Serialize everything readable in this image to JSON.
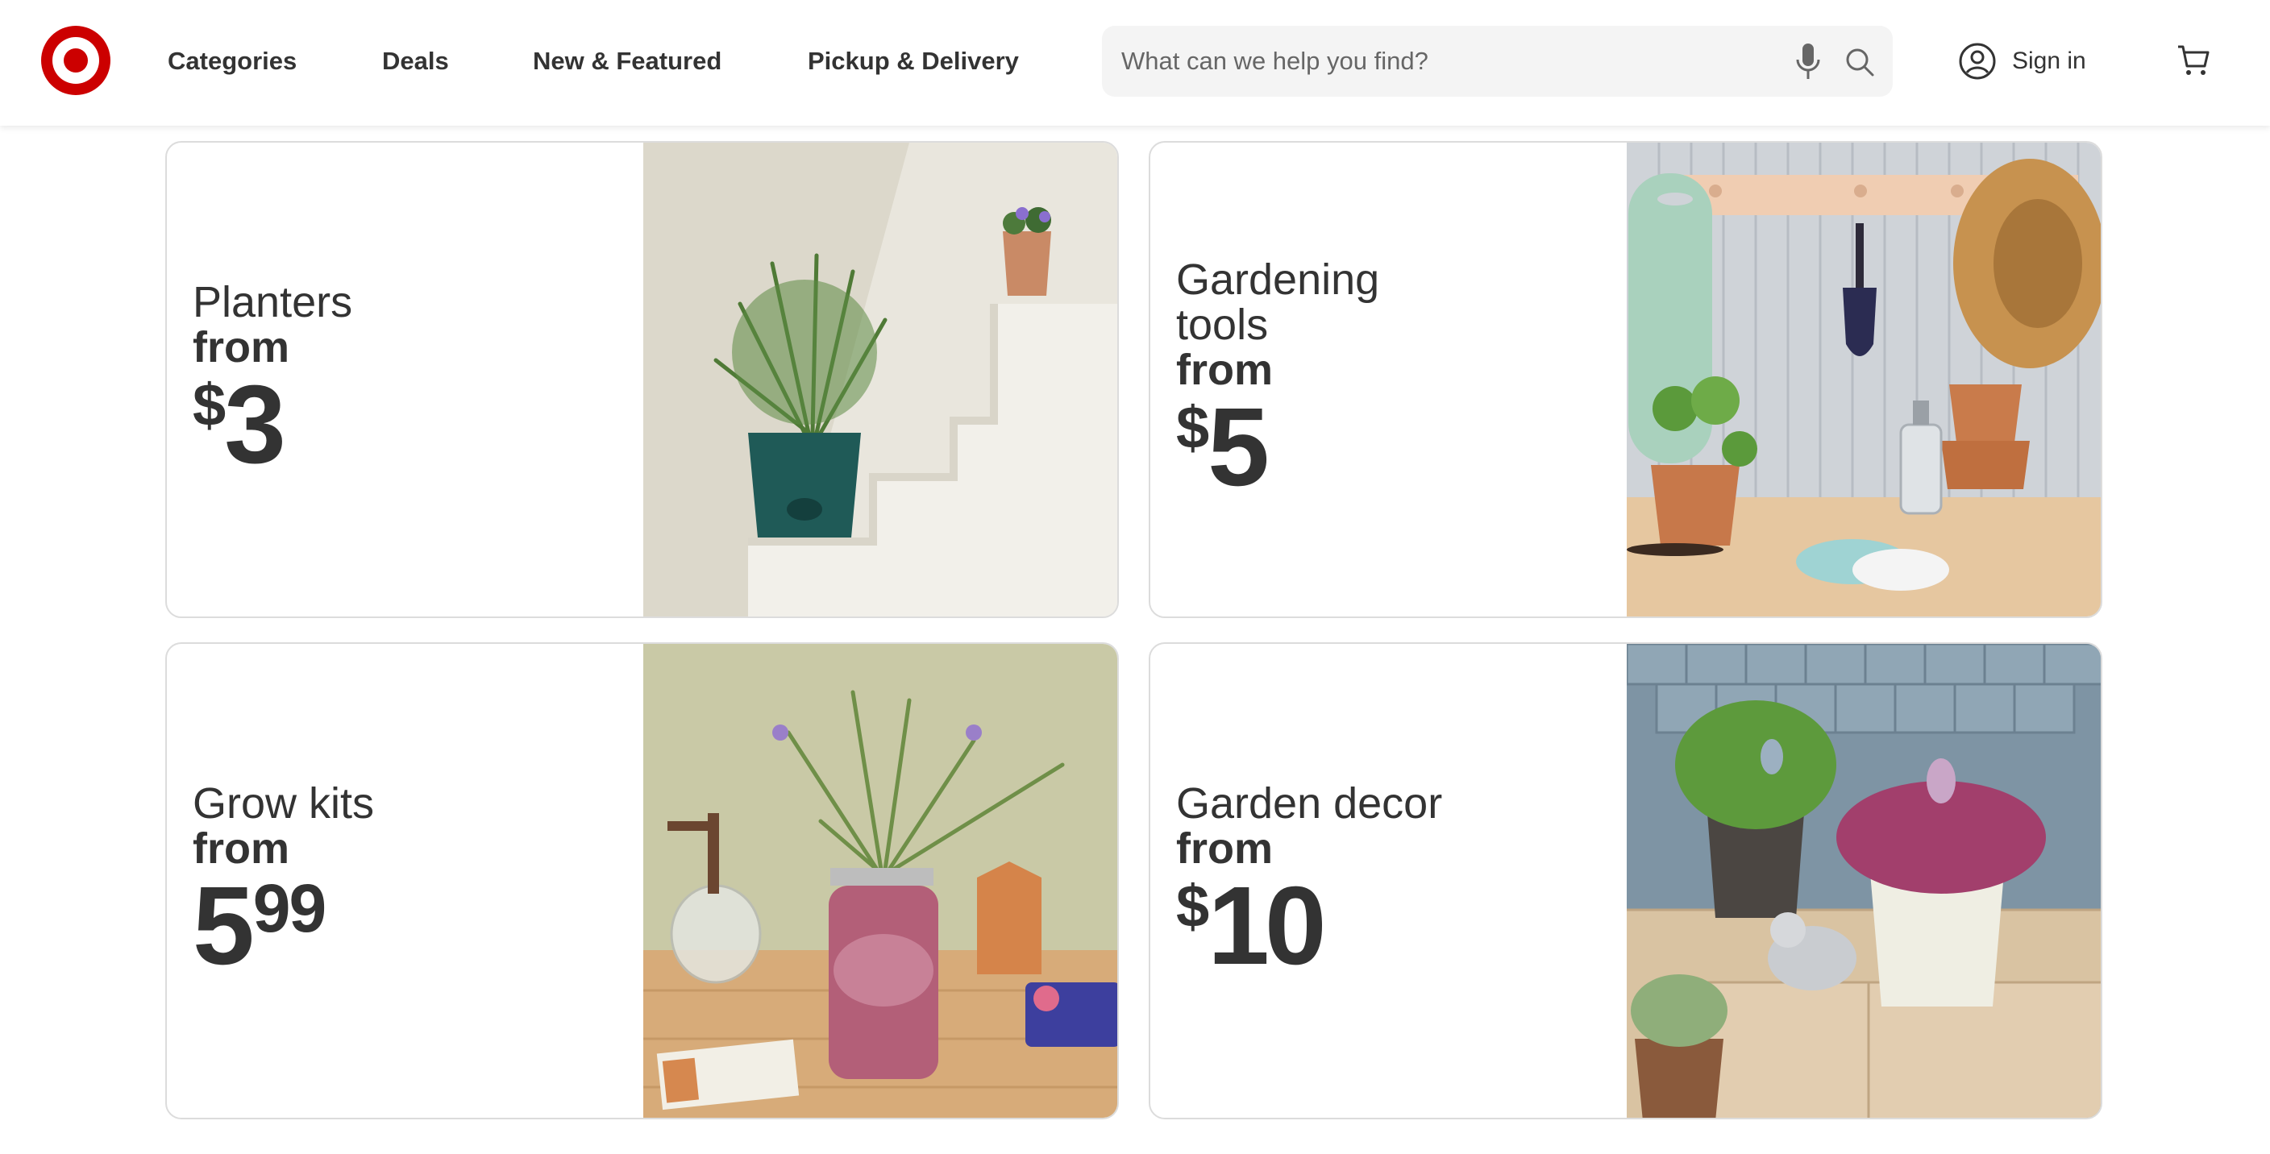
{
  "header": {
    "nav": [
      "Categories",
      "Deals",
      "New & Featured",
      "Pickup & Delivery"
    ],
    "search_placeholder": "What can we help you find?",
    "signin": "Sign in",
    "icons": [
      "target-logo",
      "mic-icon",
      "search-icon",
      "account-icon",
      "cart-icon"
    ],
    "brand_color": "#cc0000"
  },
  "cards": [
    {
      "title_lines": [
        "Planters"
      ],
      "from": "from",
      "currency": "$",
      "price": "3",
      "cents": "",
      "image": "teal-planter-with-rosemary-on-white-stairs"
    },
    {
      "title_lines": [
        "Gardening",
        "tools"
      ],
      "from": "from",
      "currency": "$",
      "price": "5",
      "cents": "",
      "image": "garden-tools-on-wall-pegs-with-hat-and-pots"
    },
    {
      "title_lines": [
        "Grow kits"
      ],
      "from": "from",
      "currency": "",
      "price": "5",
      "cents": "99",
      "image": "lavender-grow-kit-jar-with-mister"
    },
    {
      "title_lines": [
        "Garden decor"
      ],
      "from": "from",
      "currency": "$",
      "price": "10",
      "cents": "",
      "image": "decor-pots-with-ceramic-bird-on-steps"
    }
  ]
}
